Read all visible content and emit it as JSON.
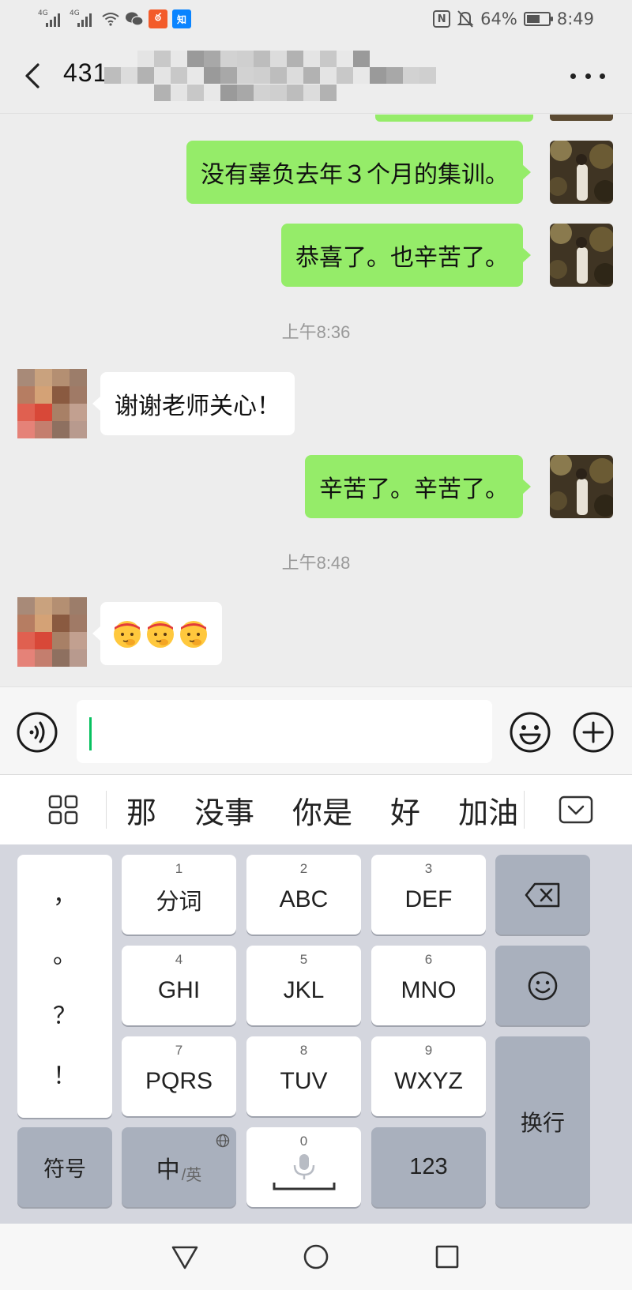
{
  "status_bar": {
    "signal1_label": "4G",
    "signal2_label": "4G",
    "battery_percent": "64%",
    "battery_level": 0.64,
    "time": "8:49",
    "app_icon_label": "知",
    "icons": [
      "signal-icon",
      "signal-icon",
      "wifi-icon",
      "wechat-icon",
      "app-orange-icon",
      "zhihu-icon",
      "nfc-icon",
      "mute-icon",
      "battery-icon"
    ]
  },
  "header": {
    "title_visible": "431",
    "icons": [
      "back-icon",
      "more-icon"
    ]
  },
  "messages": [
    {
      "side": "out",
      "text": "没有辜负去年３个月的集训。"
    },
    {
      "side": "out",
      "text": "恭喜了。也辛苦了。"
    },
    {
      "type": "time",
      "text": "上午8:36"
    },
    {
      "side": "in",
      "text": "谢谢老师关心！"
    },
    {
      "side": "out",
      "text": "辛苦了。辛苦了。"
    },
    {
      "type": "time",
      "text": "上午8:48"
    },
    {
      "side": "in",
      "emoji": [
        "salute-emoji",
        "salute-emoji",
        "salute-emoji"
      ]
    }
  ],
  "input_bar": {
    "value": "",
    "icons": [
      "voice-icon",
      "emoji-icon",
      "plus-icon"
    ]
  },
  "candidates": {
    "items": [
      "那",
      "没事",
      "你是",
      "好",
      "加油"
    ],
    "icons": [
      "grid-icon",
      "collapse-icon"
    ]
  },
  "keyboard": {
    "punct": [
      "，",
      "。",
      "？",
      "！"
    ],
    "keys": [
      {
        "num": "1",
        "label": "分词"
      },
      {
        "num": "2",
        "label": "ABC"
      },
      {
        "num": "3",
        "label": "DEF"
      },
      {
        "num": "4",
        "label": "GHI"
      },
      {
        "num": "5",
        "label": "JKL"
      },
      {
        "num": "6",
        "label": "MNO"
      },
      {
        "num": "7",
        "label": "PQRS"
      },
      {
        "num": "8",
        "label": "TUV"
      },
      {
        "num": "9",
        "label": "WXYZ"
      }
    ],
    "symbol_label": "符号",
    "lang_main": "中",
    "lang_sub": "/英",
    "space_num": "0",
    "num_label": "123",
    "enter_label": "换行",
    "icons": [
      "backspace-icon",
      "smiley-icon",
      "globe-icon",
      "mic-icon"
    ]
  },
  "nav": {
    "icons": [
      "nav-back-icon",
      "nav-home-icon",
      "nav-recent-icon"
    ]
  },
  "colors": {
    "bg": "#ededed",
    "bubble_out": "#95ec69",
    "bubble_in": "#ffffff",
    "accent": "#07c160",
    "keyboard_bg": "#d4d6de",
    "key_dark": "#a9b0bd"
  }
}
